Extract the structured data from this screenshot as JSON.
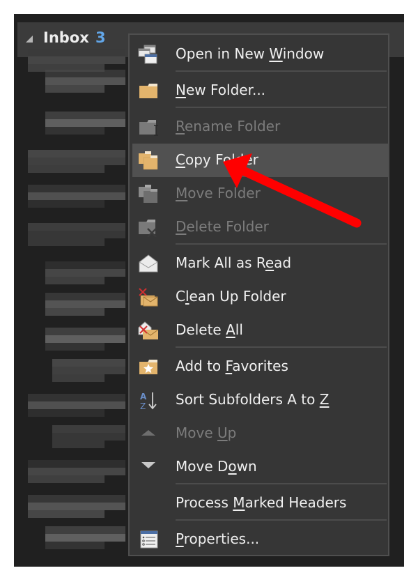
{
  "folder_pane": {
    "folder_name": "Inbox",
    "unread_count": "3",
    "expand_icon": "collapse-triangle-icon"
  },
  "context_menu": {
    "items": [
      {
        "label_pre": "Open in New ",
        "label_key": "W",
        "label_post": "indow",
        "icon": "new-window-icon",
        "enabled": true
      },
      {
        "label_pre": "",
        "label_key": "N",
        "label_post": "ew Folder...",
        "icon": "new-folder-icon",
        "enabled": true
      },
      {
        "label_pre": "",
        "label_key": "R",
        "label_post": "ename Folder",
        "icon": "rename-folder-icon",
        "enabled": false
      },
      {
        "label_pre": "",
        "label_key": "C",
        "label_post": "opy Folder",
        "icon": "copy-folder-icon",
        "enabled": true,
        "highlighted": true
      },
      {
        "label_pre": "",
        "label_key": "M",
        "label_post": "ove Folder",
        "icon": "move-folder-icon",
        "enabled": false
      },
      {
        "label_pre": "",
        "label_key": "D",
        "label_post": "elete Folder",
        "icon": "delete-folder-icon",
        "enabled": false
      },
      {
        "label_pre": "Mark All as R",
        "label_key": "e",
        "label_post": "ad",
        "icon": "mark-read-envelope-icon",
        "enabled": true
      },
      {
        "label_pre": "C",
        "label_key": "l",
        "label_post": "ean Up Folder",
        "icon": "clean-up-folder-icon",
        "enabled": true
      },
      {
        "label_pre": "Delete ",
        "label_key": "A",
        "label_post": "ll",
        "icon": "delete-all-envelope-icon",
        "enabled": true
      },
      {
        "label_pre": "Add to ",
        "label_key": "F",
        "label_post": "avorites",
        "icon": "favorites-folder-icon",
        "enabled": true
      },
      {
        "label_pre": "Sort Subfolders A to ",
        "label_key": "Z",
        "label_post": "",
        "icon": "sort-az-icon",
        "enabled": true
      },
      {
        "label_pre": "Move ",
        "label_key": "U",
        "label_post": "p",
        "icon": "move-up-triangle-icon",
        "enabled": false
      },
      {
        "label_pre": "Move D",
        "label_key": "o",
        "label_post": "wn",
        "icon": "move-down-triangle-icon",
        "enabled": true
      },
      {
        "label_pre": "Process ",
        "label_key": "M",
        "label_post": "arked Headers",
        "icon": "",
        "enabled": true
      },
      {
        "label_pre": "",
        "label_key": "P",
        "label_post": "roperties...",
        "icon": "properties-icon",
        "enabled": true
      }
    ]
  },
  "annotation": {
    "arrow_color": "#ff0000",
    "points_to": "Copy Folder"
  }
}
